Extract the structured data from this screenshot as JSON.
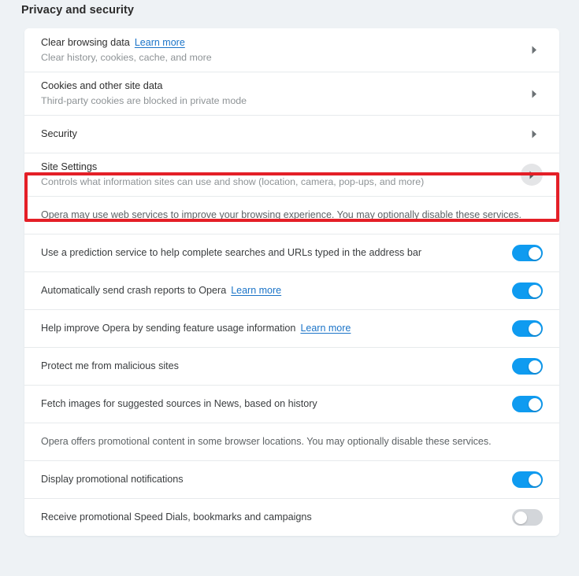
{
  "page": {
    "title": "Privacy and security",
    "background_color": "#eef2f5",
    "card_color": "#ffffff",
    "accent_color": "#0f9bf0",
    "link_color": "#1b74c8",
    "highlight_color": "#e41f27"
  },
  "nav_rows": [
    {
      "primary": "Clear browsing data",
      "link": "Learn more",
      "secondary": "Clear history, cookies, cache, and more",
      "arrow": "chevron-right-icon"
    },
    {
      "primary": "Cookies and other site data",
      "link": "",
      "secondary": "Third-party cookies are blocked in private mode",
      "arrow": "chevron-right-icon"
    },
    {
      "primary": "Security",
      "link": "",
      "secondary": "",
      "arrow": "chevron-right-icon"
    },
    {
      "primary": "Site Settings",
      "link": "",
      "secondary": "Controls what information sites can use and show (location, camera, pop-ups, and more)",
      "arrow": "chevron-right-circle-icon",
      "highlighted": true
    }
  ],
  "notes": {
    "web_services": "Opera may use web services to improve your browsing experience. You may optionally disable these services.",
    "promotional": "Opera offers promotional content in some browser locations. You may optionally disable these services."
  },
  "service_toggles": [
    {
      "label": "Use a prediction service to help complete searches and URLs typed in the address bar",
      "link": "",
      "state": "on"
    },
    {
      "label": "Automatically send crash reports to Opera",
      "link": "Learn more",
      "state": "on"
    },
    {
      "label": "Help improve Opera by sending feature usage information",
      "link": "Learn more",
      "state": "on"
    },
    {
      "label": "Protect me from malicious sites",
      "link": "",
      "state": "on"
    },
    {
      "label": "Fetch images for suggested sources in News, based on history",
      "link": "",
      "state": "on"
    }
  ],
  "promo_toggles": [
    {
      "label": "Display promotional notifications",
      "link": "",
      "state": "on"
    },
    {
      "label": "Receive promotional Speed Dials, bookmarks and campaigns",
      "link": "",
      "state": "off"
    }
  ]
}
